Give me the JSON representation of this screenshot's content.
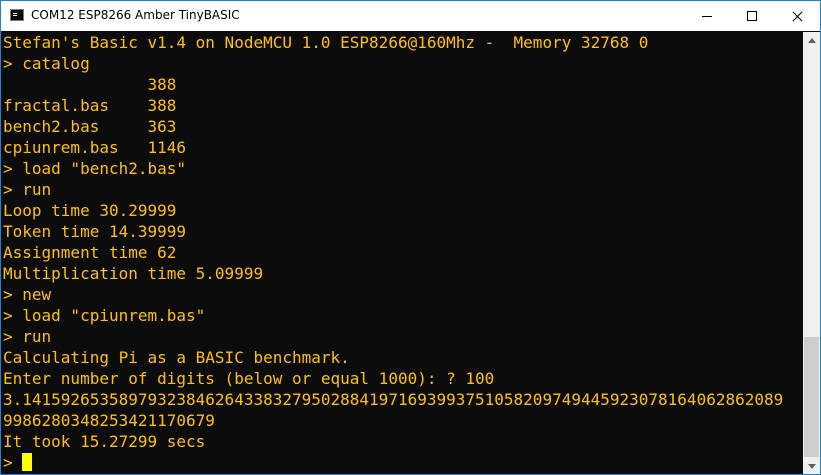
{
  "window": {
    "title": "COM12 ESP8266 Amber TinyBASIC",
    "icon": "terminal-icon",
    "controls": [
      "minimize-icon",
      "maximize-icon",
      "close-icon"
    ]
  },
  "console": {
    "lines": [
      "Stefan's Basic v1.4 on NodeMCU 1.0 ESP8266@160Mhz -  Memory 32768 0",
      "> catalog",
      "               388",
      "fractal.bas    388",
      "bench2.bas     363",
      "cpiunrem.bas   1146",
      "> load \"bench2.bas\"",
      "> run",
      "Loop time 30.29999",
      "Token time 14.39999",
      "Assignment time 62",
      "Multiplication time 5.09999",
      "> new",
      "> load \"cpiunrem.bas\"",
      "> run",
      "Calculating Pi as a BASIC benchmark.",
      "Enter number of digits (below or equal 1000): ? 100",
      "3.1415926535897932384626433832795028841971693993751058209749445923078164062862089",
      "9986280348253421170679",
      "It took 15.27299 secs",
      ">"
    ],
    "text_color": "#ffc000",
    "cursor_color": "#ffff00",
    "background": "#0c0c0c"
  },
  "scrollbar": {
    "position": 0.85
  }
}
